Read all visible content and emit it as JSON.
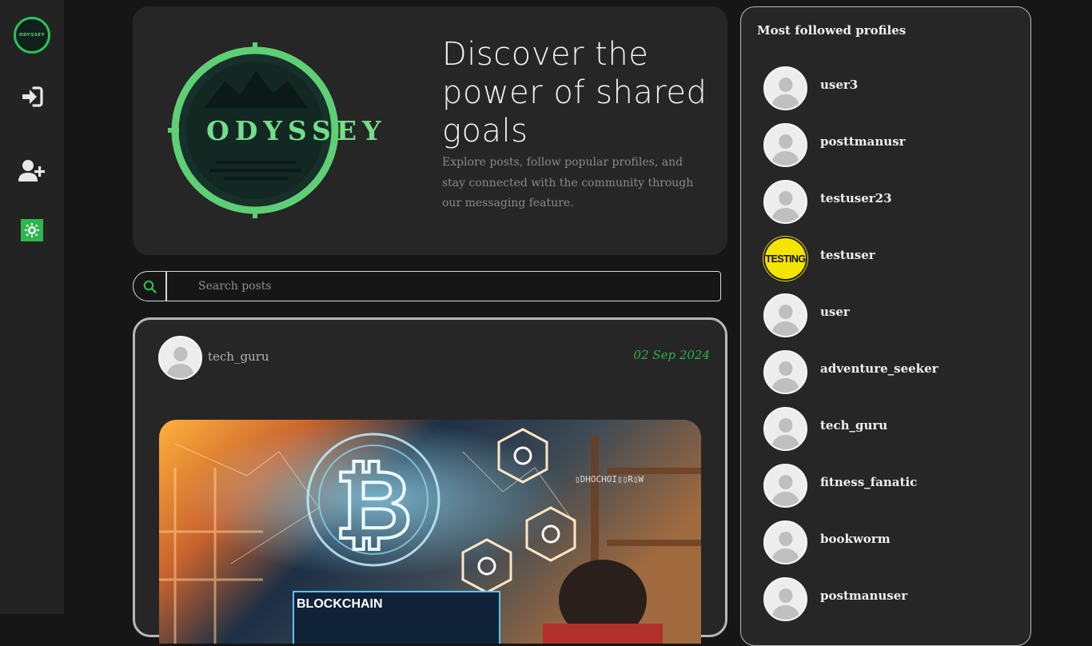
{
  "sidebar": {
    "logo_text": "ODYSSEY",
    "icons": [
      "login-icon",
      "add-user-icon",
      "theme-toggle-icon"
    ],
    "accent_color": "#2db84d"
  },
  "hero": {
    "logo_text": "ODYSSEY",
    "title": "Discover the power of shared goals",
    "description": "Explore posts, follow popular profiles, and stay connected with the community through our messaging feature."
  },
  "search": {
    "placeholder": "Search posts"
  },
  "post": {
    "username": "tech_guru",
    "date": "02 Sep 2024",
    "image_label": "BLOCKCHAIN"
  },
  "panel": {
    "title": "Most followed profiles",
    "profiles": [
      {
        "name": "user3",
        "avatar": "default"
      },
      {
        "name": "posttmanusr",
        "avatar": "default"
      },
      {
        "name": "testuser23",
        "avatar": "default"
      },
      {
        "name": "testuser",
        "avatar": "testing",
        "avatar_text": "TESTING"
      },
      {
        "name": "user",
        "avatar": "default"
      },
      {
        "name": "adventure_seeker",
        "avatar": "default"
      },
      {
        "name": "tech_guru",
        "avatar": "default"
      },
      {
        "name": "fitness_fanatic",
        "avatar": "default"
      },
      {
        "name": "bookworm",
        "avatar": "default"
      },
      {
        "name": "postmanuser",
        "avatar": "default"
      }
    ]
  }
}
